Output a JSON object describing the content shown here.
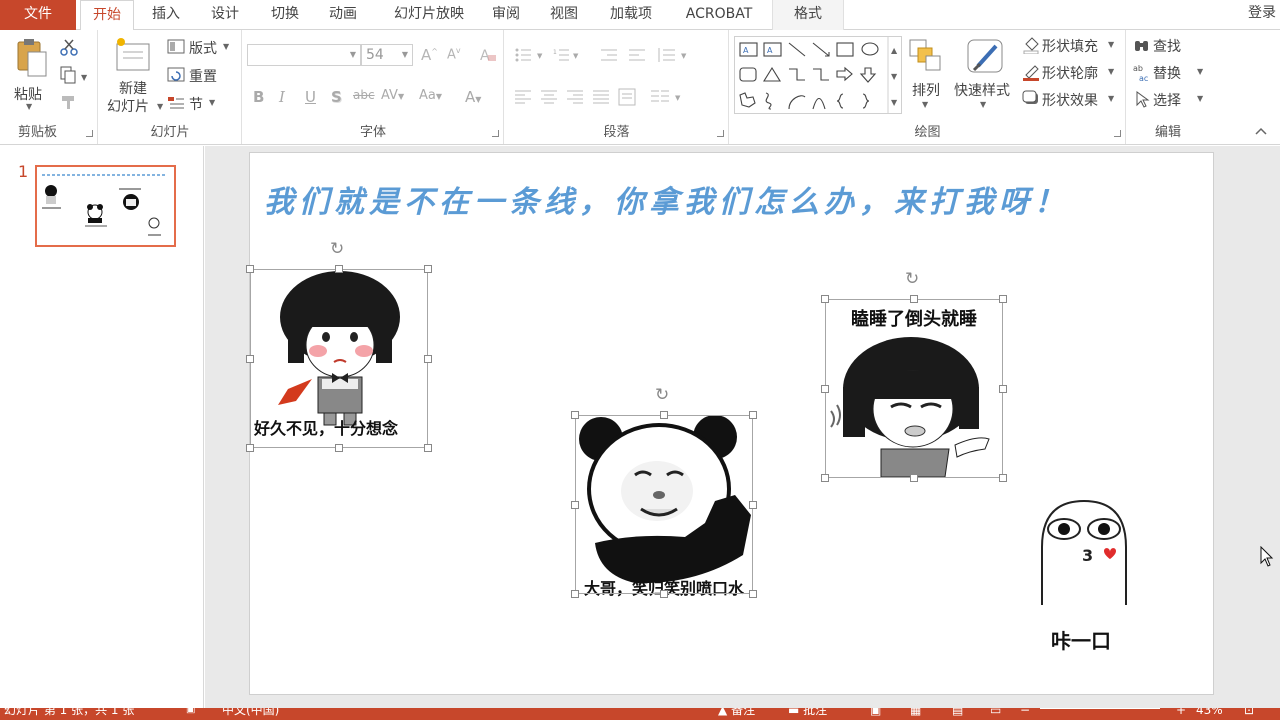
{
  "app": {
    "login": "登录"
  },
  "tabs": [
    {
      "label": "文件"
    },
    {
      "label": "开始"
    },
    {
      "label": "插入"
    },
    {
      "label": "设计"
    },
    {
      "label": "切换"
    },
    {
      "label": "动画"
    },
    {
      "label": "幻灯片放映"
    },
    {
      "label": "审阅"
    },
    {
      "label": "视图"
    },
    {
      "label": "加载项"
    },
    {
      "label": "ACROBAT"
    },
    {
      "label": "格式"
    }
  ],
  "ribbon": {
    "clipboard": {
      "label": "剪贴板",
      "paste": "粘贴"
    },
    "slides": {
      "label": "幻灯片",
      "new_slide_line1": "新建",
      "new_slide_line2": "幻灯片",
      "layout": "版式",
      "reset": "重置",
      "section": "节"
    },
    "font": {
      "label": "字体",
      "font_name": "",
      "font_size": "54"
    },
    "paragraph": {
      "label": "段落"
    },
    "drawing": {
      "label": "绘图",
      "arrange": "排列",
      "quick_styles": "快速样式",
      "shape_fill": "形状填充",
      "shape_outline": "形状轮廓",
      "shape_effects": "形状效果"
    },
    "editing": {
      "label": "编辑",
      "find": "查找",
      "replace": "替换",
      "select": "选择"
    }
  },
  "thumbnails": [
    {
      "number": "1"
    }
  ],
  "slide": {
    "title": "我们就是不在一条线，你拿我们怎么办，来打我呀！",
    "memes": [
      {
        "caption": "好久不见，十分想念"
      },
      {
        "caption": "大哥，笑归笑别喷口水"
      },
      {
        "caption": "瞌睡了倒头就睡"
      },
      {
        "caption": "咔一口"
      }
    ]
  },
  "status": {
    "slide_info": "幻灯片 第 1 张，共 1 张",
    "language": "中文(中国)",
    "notes": "备注",
    "comments": "批注",
    "zoom": "43%"
  },
  "colors": {
    "accent": "#c7472b",
    "title_blue": "#5b9bd5"
  }
}
